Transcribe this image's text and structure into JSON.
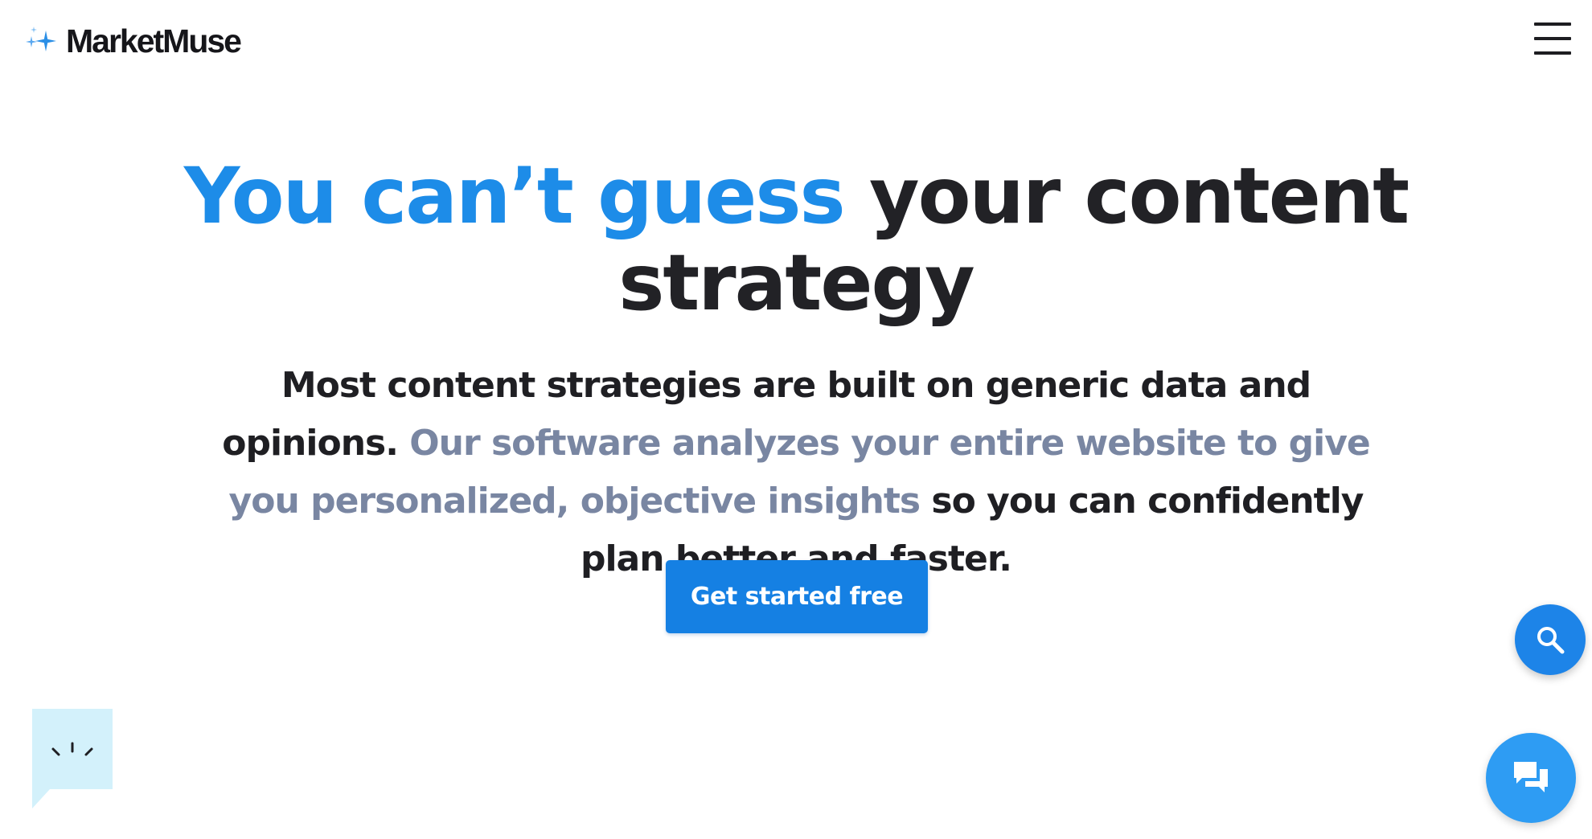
{
  "header": {
    "logo_text": "MarketMuse",
    "logo_icon": "sparkle-stars-icon",
    "menu_icon": "hamburger-menu-icon"
  },
  "hero": {
    "title_accent": "You can’t guess",
    "title_rest": " your content strategy",
    "subtitle_part1": "Most content strategies are built on generic data and opinions. ",
    "subtitle_part2": "Our software analyzes your entire website to give you personalized, objective insights",
    "subtitle_part3": " so you can confidently plan better and faster.",
    "cta_label": "Get started free"
  },
  "floating": {
    "search_icon": "search-icon",
    "chat_icon": "chat-bubbles-icon",
    "widget_icon": "speech-bubble-face-icon"
  },
  "colors": {
    "accent": "#1d8ce8",
    "muted_text": "#7986a2",
    "button": "#1580e3",
    "chat_fab": "#2e9cf3",
    "widget_bg": "#d3f1fb"
  }
}
